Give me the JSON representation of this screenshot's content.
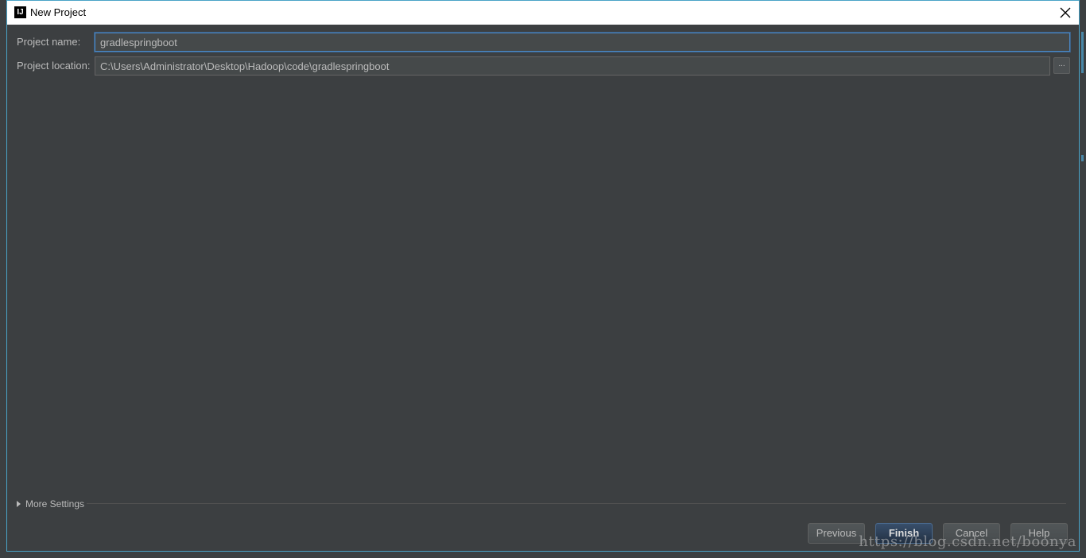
{
  "window": {
    "title": "New Project",
    "app_icon_text": "IJ"
  },
  "form": {
    "project_name_label": "Project name:",
    "project_name_value": "gradlespringboot",
    "project_location_label": "Project location:",
    "project_location_value": "C:\\Users\\Administrator\\Desktop\\Hadoop\\code\\gradlespringboot",
    "browse_label": "..."
  },
  "more_settings": {
    "label": "More Settings",
    "expanded": false
  },
  "buttons": {
    "previous": "Previous",
    "finish": "Finish",
    "cancel": "Cancel",
    "help": "Help"
  },
  "watermark": "https://blog.csdn.net/boonya",
  "colors": {
    "dialog_bg": "#3c3f41",
    "focus_border": "#4a88c7",
    "window_border": "#4aa3c7",
    "text": "#bbbbbb"
  },
  "icons": {
    "app": "intellij-idea-icon",
    "close": "close-icon",
    "expand": "triangle-right-icon"
  }
}
